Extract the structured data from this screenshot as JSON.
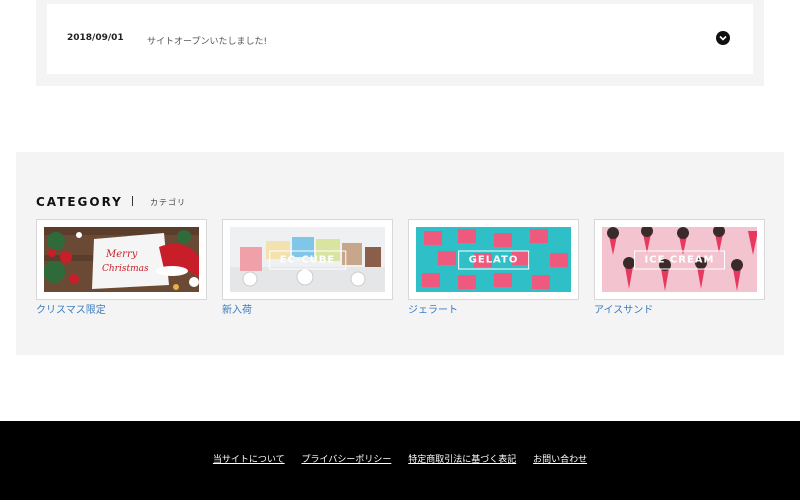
{
  "news": {
    "items": [
      {
        "date": "2018/09/01",
        "title": "サイトオープンいたしました!"
      }
    ]
  },
  "category": {
    "heading": "CATEGORY",
    "subheading": "カテゴリ",
    "cards": [
      {
        "label": "クリスマス限定",
        "overlay": "",
        "image_text": "Merry Christmas"
      },
      {
        "label": "新入荷",
        "overlay": "EC-CUBE"
      },
      {
        "label": "ジェラート",
        "overlay": "GELATO"
      },
      {
        "label": "アイスサンド",
        "overlay": "ICE CREAM"
      }
    ]
  },
  "footer": {
    "links": [
      "当サイトについて",
      "プライバシーポリシー",
      "特定商取引法に基づく表記",
      "お問い合わせ"
    ]
  },
  "colors": {
    "link": "#3a7bbf",
    "footer_bg": "#000000",
    "section_bg": "#f4f4f4",
    "gelato_bg": "#2fbfc7",
    "icecream_bg": "#f3c4cf"
  },
  "icons": {
    "news_toggle": "chevron-down-circle-icon"
  }
}
